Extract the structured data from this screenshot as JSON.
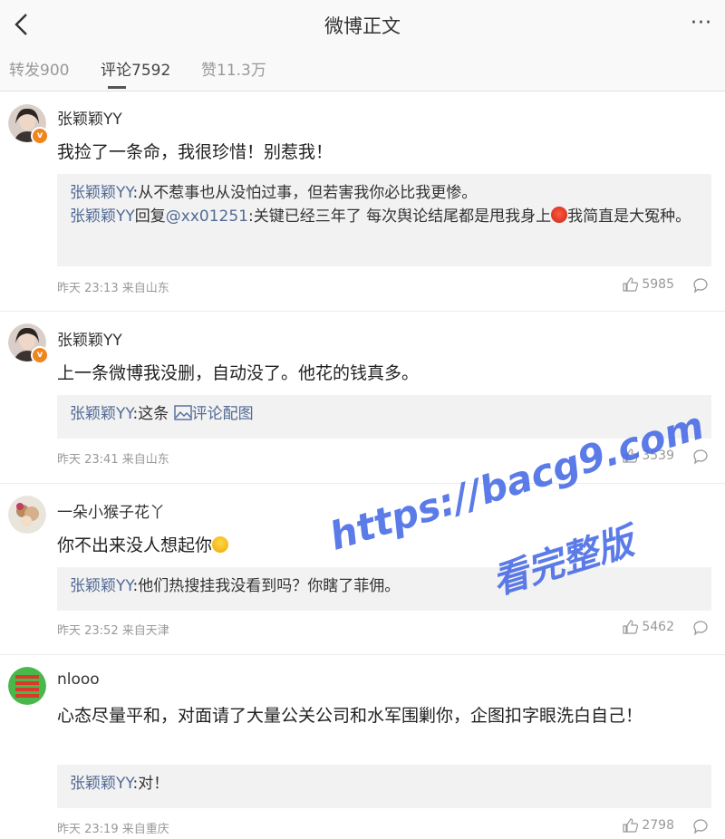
{
  "header": {
    "title": "微博正文",
    "more": "···"
  },
  "tabs": [
    {
      "label": "转发900"
    },
    {
      "label": "评论7592"
    },
    {
      "label": "赞11.3万"
    }
  ],
  "comments": [
    {
      "user": "张颖颖YY",
      "text": "我捡了一条命，我很珍惜！别惹我！",
      "reply": {
        "line1_user": "张颖颖YY",
        "line1_text": ":从不惹事也从没怕过事，但若害我你必比我更惨。",
        "line2_user": "张颖颖YY",
        "line2_mid": "回复",
        "line2_at": "@xx01251",
        "line2_text": ":关键已经三年了 每次舆论结尾都是甩我身上",
        "line2_after": "我简直是大冤种。"
      },
      "meta": "昨天 23:13 来自山东",
      "likes": "5985"
    },
    {
      "user": "张颖颖YY",
      "text": "上一条微博我没删，自动没了。他花的钱真多。",
      "reply": {
        "user": "张颖颖YY",
        "text": ":这条 ",
        "pic_label": "评论配图"
      },
      "meta": "昨天 23:41 来自山东",
      "likes": "3539"
    },
    {
      "user": "一朵小猴子花丫",
      "text": "你不出来没人想起你",
      "reply": {
        "user": "张颖颖YY",
        "text": ":他们热搜挂我没看到吗？你瞎了菲佣。"
      },
      "meta": "昨天 23:52 来自天津",
      "likes": "5462"
    },
    {
      "user": "nlooo",
      "text": "心态尽量平和，对面请了大量公关公司和水军围剿你，企图扣字眼洗白自己！",
      "reply": {
        "user": "张颖颖YY",
        "text": ":对！"
      },
      "meta": "昨天 23:19 来自重庆",
      "likes": "2798"
    }
  ],
  "watermark": {
    "line1": "https://bacg9.com",
    "line2": "看完整版"
  },
  "colors": {
    "link": "#526a96",
    "watermark": "#4a6de6",
    "vbadge": "#f0851e"
  }
}
